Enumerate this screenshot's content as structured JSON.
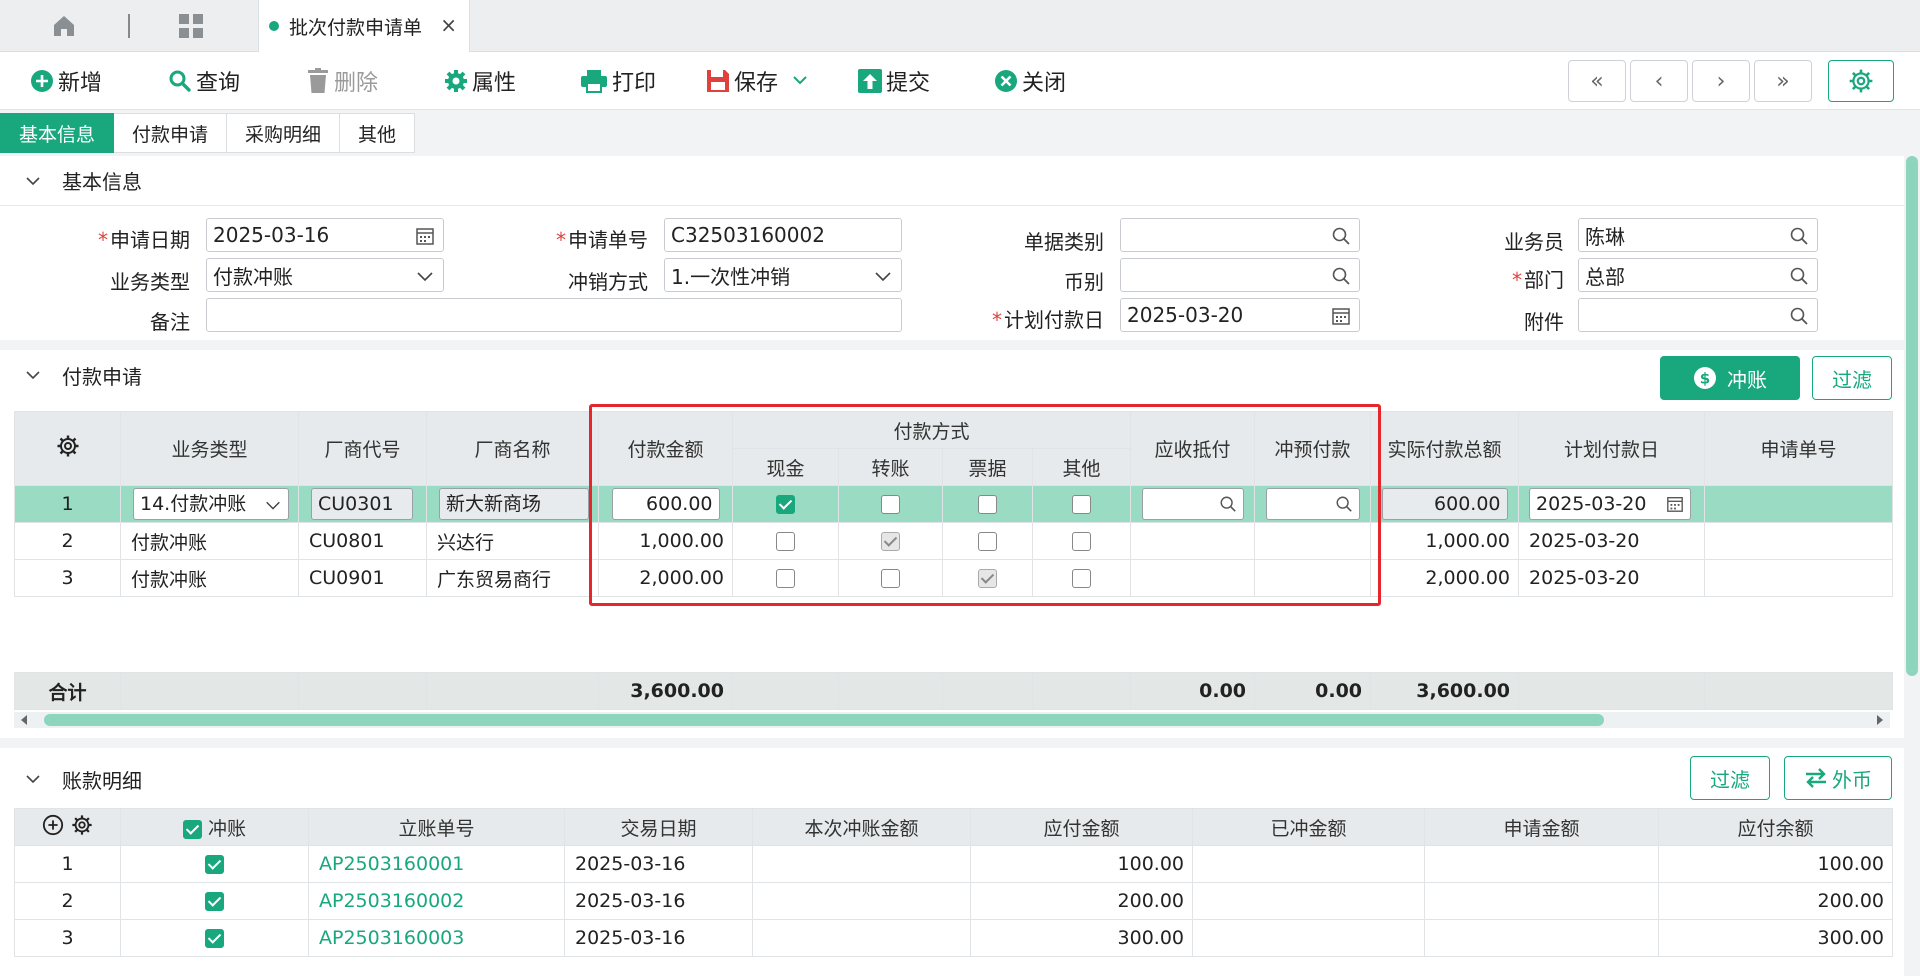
{
  "tabbar": {
    "doc_tab_title": "批次付款申请单",
    "close_glyph": "×"
  },
  "toolbar": {
    "add": "新增",
    "query": "查询",
    "delete": "删除",
    "props": "属性",
    "print": "打印",
    "save": "保存",
    "submit": "提交",
    "close": "关闭",
    "nav_first": "«",
    "nav_prev": "‹",
    "nav_next": "›",
    "nav_last": "»"
  },
  "section_tabs": [
    "基本信息",
    "付款申请",
    "采购明细",
    "其他"
  ],
  "basic": {
    "title": "基本信息",
    "apply_date_label": "申请日期",
    "apply_date": "2025-03-16",
    "apply_no_label": "申请单号",
    "apply_no": "C32503160002",
    "doc_type_label": "单据类别",
    "doc_type": "",
    "salesman_label": "业务员",
    "salesman": "陈琳",
    "biz_type_label": "业务类型",
    "biz_type": "付款冲账",
    "offset_label": "冲销方式",
    "offset": "1.一次性冲销",
    "currency_label": "币别",
    "currency": "",
    "dept_label": "部门",
    "dept": "总部",
    "remark_label": "备注",
    "remark": "",
    "plan_date_label": "计划付款日",
    "plan_date": "2025-03-20",
    "attach_label": "附件",
    "attach": ""
  },
  "payment": {
    "title": "付款申请",
    "offset_btn": "冲账",
    "filter_btn": "过滤",
    "headers": {
      "biz_type": "业务类型",
      "vendor_code": "厂商代号",
      "vendor_name": "厂商名称",
      "amount": "付款金额",
      "method": "付款方式",
      "cash": "现金",
      "transfer": "转账",
      "bill": "票据",
      "other": "其他",
      "ar_offset": "应收抵付",
      "prepay_offset": "冲预付款",
      "actual_total": "实际付款总额",
      "plan_date": "计划付款日",
      "apply_no": "申请单号"
    },
    "rows": [
      {
        "no": "1",
        "biz_type": "14.付款冲账",
        "vendor_code": "CU0301",
        "vendor_name": "新大新商场",
        "amount": "600.00",
        "actual_total": "600.00",
        "plan_date": "2025-03-20"
      },
      {
        "no": "2",
        "biz_type": "付款冲账",
        "vendor_code": "CU0801",
        "vendor_name": "兴达行",
        "amount": "1,000.00",
        "actual_total": "1,000.00",
        "plan_date": "2025-03-20"
      },
      {
        "no": "3",
        "biz_type": "付款冲账",
        "vendor_code": "CU0901",
        "vendor_name": "广东贸易商行",
        "amount": "2,000.00",
        "actual_total": "2,000.00",
        "plan_date": "2025-03-20"
      }
    ],
    "totals": {
      "label": "合计",
      "amount": "3,600.00",
      "ar_offset": "0.00",
      "prepay_offset": "0.00",
      "actual_total": "3,600.00"
    }
  },
  "ledger": {
    "title": "账款明细",
    "filter_btn": "过滤",
    "fx_btn": "外币",
    "headers": {
      "offset": "冲账",
      "entry_no": "立账单号",
      "trade_date": "交易日期",
      "this_offset": "本次冲账金额",
      "payable": "应付金额",
      "offset_done": "已冲金额",
      "apply_amount": "申请金额",
      "balance": "应付余额"
    },
    "rows": [
      {
        "no": "1",
        "entry_no": "AP2503160001",
        "trade_date": "2025-03-16",
        "payable": "100.00",
        "balance": "100.00"
      },
      {
        "no": "2",
        "entry_no": "AP2503160002",
        "trade_date": "2025-03-16",
        "payable": "200.00",
        "balance": "200.00"
      },
      {
        "no": "3",
        "entry_no": "AP2503160003",
        "trade_date": "2025-03-16",
        "payable": "300.00",
        "balance": "300.00"
      }
    ]
  },
  "colors": {
    "accent": "#19a87d",
    "selected_row": "#9adbc4",
    "highlight_box": "#e5262b"
  }
}
